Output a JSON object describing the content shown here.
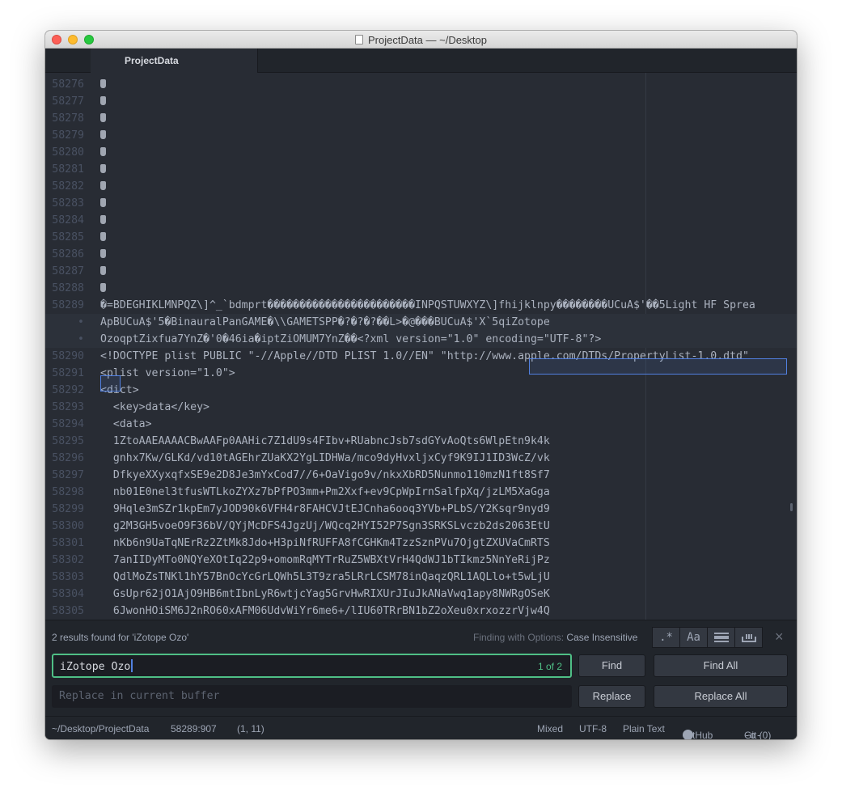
{
  "window": {
    "title": "ProjectData — ~/Desktop"
  },
  "tabs": [
    {
      "label": "ProjectData"
    }
  ],
  "editor": {
    "lines": [
      {
        "num": "58276",
        "text": "◆",
        "glyph": true
      },
      {
        "num": "58277",
        "text": "◆",
        "glyph": true
      },
      {
        "num": "58278",
        "text": "◆",
        "glyph": true
      },
      {
        "num": "58279",
        "text": "◆",
        "glyph": true
      },
      {
        "num": "58280",
        "text": "◆",
        "glyph": true
      },
      {
        "num": "58281",
        "text": "◆",
        "glyph": true
      },
      {
        "num": "58282",
        "text": "◆",
        "glyph": true
      },
      {
        "num": "58283",
        "text": "◆",
        "glyph": true
      },
      {
        "num": "58284",
        "text": "◆",
        "glyph": true
      },
      {
        "num": "58285",
        "text": "◆",
        "glyph": true
      },
      {
        "num": "58286",
        "text": "◆",
        "glyph": true
      },
      {
        "num": "58287",
        "text": "◆",
        "glyph": true
      },
      {
        "num": "58288",
        "text": "◆",
        "glyph": true
      },
      {
        "num": "58289",
        "text": "�=BDEGHIKLMNPQZ\\]^_`bdmprt�����������������������INPQSTUWXYZ\\]fhijklnpy��������UCuA$'��5Light HF Sprea"
      },
      {
        "num": "•",
        "text": "ApBUCuA$'5�BinauralPanGAME�\\\\GAMETSPP�?�?�?��L>�@���BUCuA$'X`5qiZotope",
        "cursor": true
      },
      {
        "num": "•",
        "text": "OzoqptZixfua7YnZ�'0�46ia�iptZiOMUM7YnZ��<?xml version=\"1.0\" encoding=\"UTF-8\"?>",
        "cursor": true
      },
      {
        "num": "58290",
        "text": "<!DOCTYPE plist PUBLIC \"-//Apple//DTD PLIST 1.0//EN\" \"http://www.apple.com/DTDs/PropertyList-1.0.dtd\""
      },
      {
        "num": "58291",
        "text": "<plist version=\"1.0\">"
      },
      {
        "num": "58292",
        "text": "<dict>"
      },
      {
        "num": "58293",
        "text": "  <key>data</key>"
      },
      {
        "num": "58294",
        "text": "  <data>"
      },
      {
        "num": "58295",
        "text": "  1ZtoAAEAAAACBwAAFp0AAHic7Z1dU9s4FIbv+RUabncJsb7sdGYvAoQts6WlpEtn9k4k"
      },
      {
        "num": "58296",
        "text": "  gnhx7Kw/GLKd/vd10tAGEhrZUaKX2YgLIDHWa/mco9dyHvxljxCyf9K9IJ1ID3WcZ/vk"
      },
      {
        "num": "58297",
        "text": "  DfkyeXXyxqfxSE9e2D8Je3mYxCod7//6+OaVigo9v/nkxXbRD5Nunmo110mzN1ft8Sf7"
      },
      {
        "num": "58298",
        "text": "  nb01E0nel3tfusWTLkoZYXz7bPfPO3mm+Pm2Xxf+ev9CpWpIrnSalfpXq/jzLM5XaGga"
      },
      {
        "num": "58299",
        "text": "  9Hqle3mSZr1kpEm7yJOD90k6VFH4r8FAHCVJtEJCnha6ooq3YVb+PLbS/Y2Ksqr9nyd9"
      },
      {
        "num": "58300",
        "text": "  g2M3GH5voeO9F36bV/QYjMcDFS4JgzUj/WQcq2HYI52P7Sgn3SRKSLvczb2ds2063EtU"
      },
      {
        "num": "58301",
        "text": "  nKb6n9UaTqNErRz2ZtMk8Jdo+H3piNfRUFFA8fCGHKm4TzzSznPVu7OjgtZXUVaCmRTS"
      },
      {
        "num": "58302",
        "text": "  7anIIDyMTo0NQYeXOtIq22p9+omomRqMYTrRuZ5WBXtVrH4QdWJ1bTIkmz5NnYeRijPz"
      },
      {
        "num": "58303",
        "text": "  QdlMoZsTNKl1hY57BnOcYcGrLQWh5L3T9zra5LRrLCSM78inQaqzQRL1AQLlo+t5wLjU"
      },
      {
        "num": "58304",
        "text": "  GsUpr62jO1AjO9HB6mtIbnLyR6wtjcYag5GrvHwRIXUrJIuJkANaVwq1apy8NWRgOSeK"
      },
      {
        "num": "58305",
        "text": "  6JwonHOiSM6J2nRO60xAFM06UdvWiYr6me6+/lIU60TRrBN1bZ2oXeu0xrxozzrVjw4Q"
      }
    ]
  },
  "find_panel": {
    "result_text": "2 results found for 'iZotope Ozo'",
    "options_prefix": "Finding with Options:",
    "options_value": "Case Insensitive",
    "option_buttons": [
      {
        "label": ".*",
        "icon": "regex-icon"
      },
      {
        "label": "Aa",
        "icon": "match-case-icon"
      },
      {
        "label": "",
        "icon": "selection-only-icon"
      },
      {
        "label": "",
        "icon": "whole-word-icon"
      }
    ],
    "close_label": "×",
    "find_value": "iZotope Ozo",
    "find_count": "1 of 2",
    "replace_placeholder": "Replace in current buffer",
    "find_button": "Find",
    "find_all_button": "Find All",
    "replace_button": "Replace",
    "replace_all_button": "Replace All"
  },
  "status_bar": {
    "file_path": "~/Desktop/ProjectData",
    "cursor_position": "58289:907",
    "selection": "(1, 11)",
    "line_ending": "Mixed",
    "encoding": "UTF-8",
    "grammar": "Plain Text",
    "github": "GitHub",
    "git": "Git (0)"
  },
  "colors": {
    "accent_green": "#4fbf86",
    "find_highlight": "#5180e0",
    "editor_bg": "#282c34",
    "panel_bg": "#21252b"
  }
}
